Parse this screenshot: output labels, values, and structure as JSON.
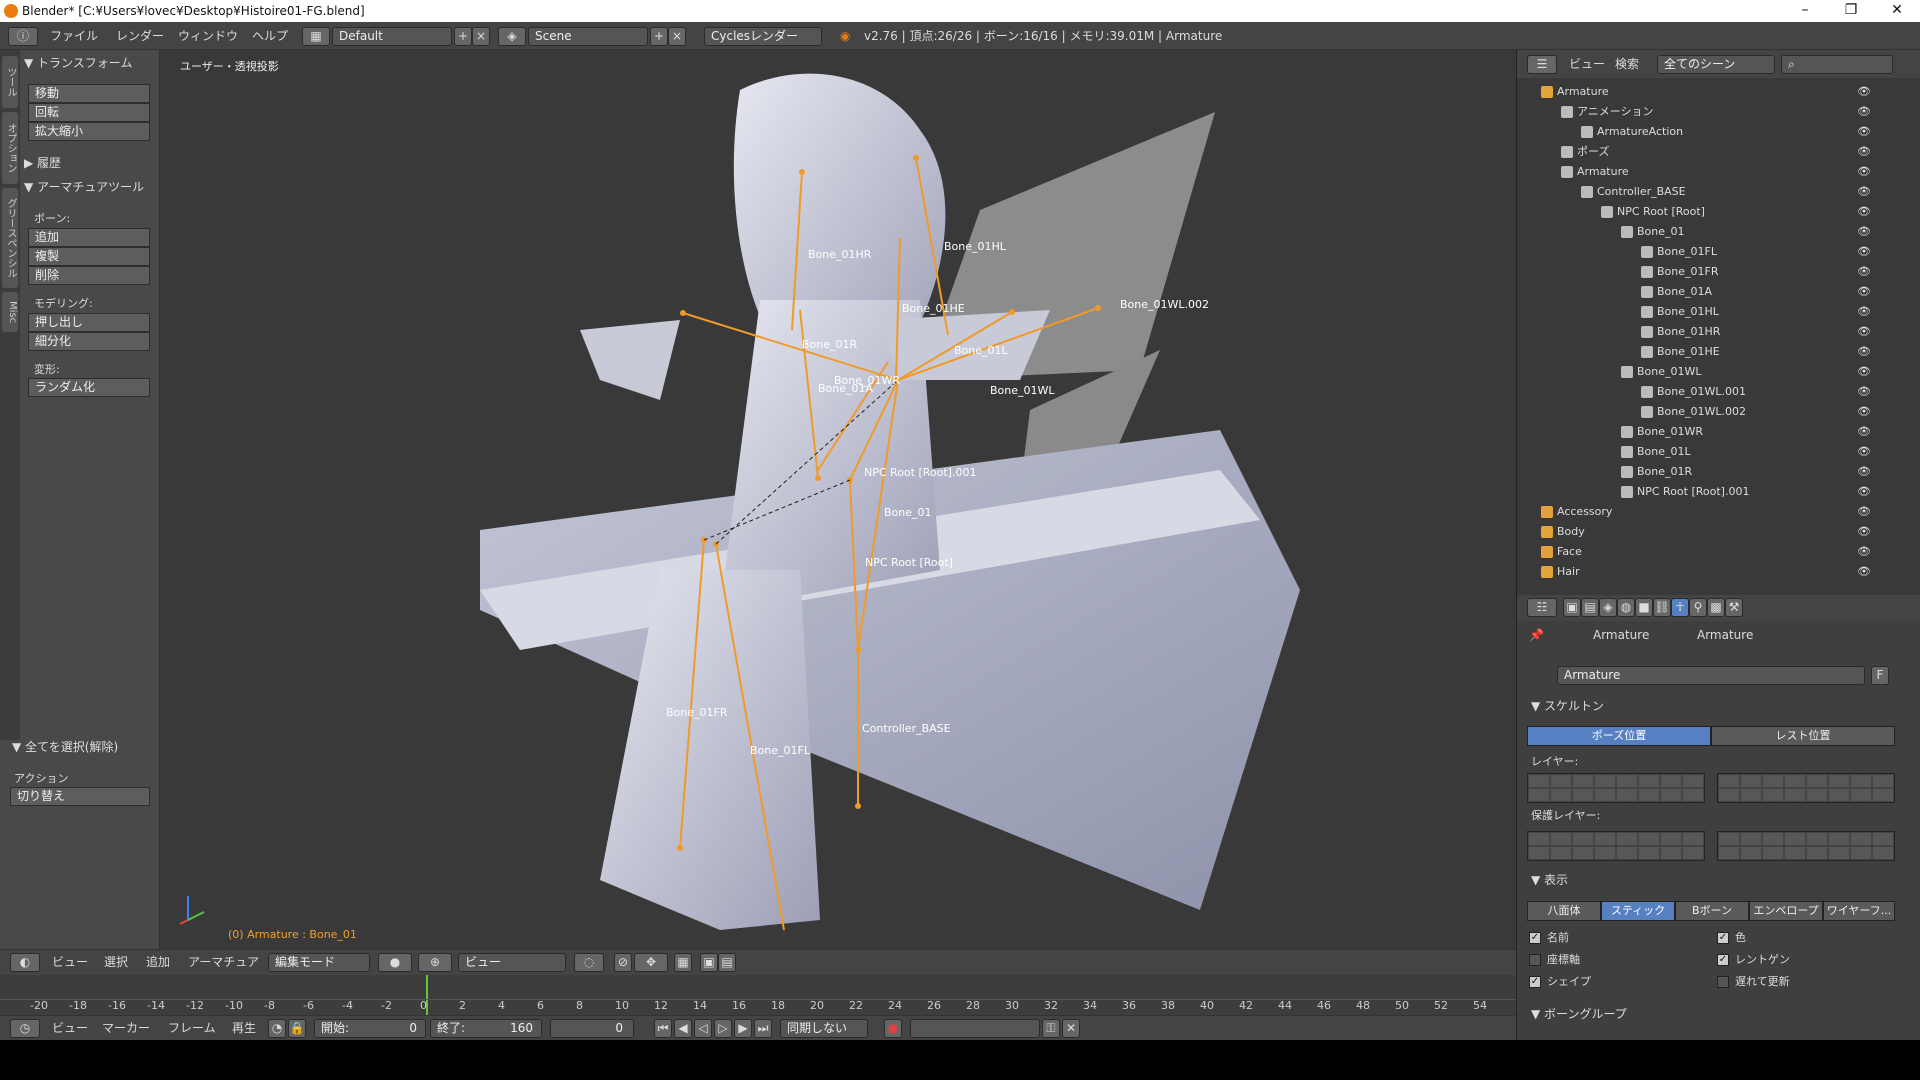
{
  "window": {
    "title": "Blender* [C:¥Users¥lovec¥Desktop¥Histoire01-FG.blend]"
  },
  "menu": [
    "ファイル",
    "レンダー",
    "ウィンドウ",
    "ヘルプ"
  ],
  "info": {
    "layout": "Default",
    "scene": "Scene",
    "engine": "Cyclesレンダー",
    "stats": "v2.76 | 頂点:26/26 | ボーン:16/16 | メモリ:39.01M | Armature"
  },
  "toolshelf": {
    "tabs": [
      "ツール",
      "オプション",
      "グリースペンシル",
      "Misc"
    ],
    "transform_header": "▼ トランスフォーム",
    "transform_buttons": [
      "移動",
      "回転",
      "拡大縮小"
    ],
    "history_header": "▶ 履歴",
    "armature_header": "▼ アーマチュアツール",
    "bones_label": "ボーン:",
    "bone_buttons": [
      "追加",
      "複製",
      "削除"
    ],
    "modeling_label": "モデリング:",
    "modeling_buttons": [
      "押し出し",
      "細分化"
    ],
    "deform_label": "変形:",
    "deform_buttons": [
      "ランダム化"
    ],
    "select_header": "▼ 全てを選択(解除)",
    "action_label": "アクション",
    "action_value": "切り替え"
  },
  "viewport": {
    "view_label": "ユーザー・透視投影",
    "status": "(0) Armature : Bone_01",
    "bone_labels": [
      "Bone_01HR",
      "Bone_01HL",
      "Bone_01HE",
      "Bone_01WL.002",
      "Bone_01R",
      "Bone_01L",
      "Bone_01WR",
      "Bone_01A",
      "Bone_01WL",
      "NPC Root [Root].001",
      "Bone_01",
      "NPC Root [Root]",
      "Bone_01FR",
      "Bone_01FL",
      "Controller_BASE"
    ]
  },
  "vp_header": {
    "items": [
      "ビュー",
      "選択",
      "追加",
      "アーマチュア"
    ],
    "mode": "編集モード",
    "view": "ビュー"
  },
  "timeline": {
    "ticks": [
      "-20",
      "-18",
      "-16",
      "-14",
      "-12",
      "-10",
      "-8",
      "-6",
      "-4",
      "-2",
      "0",
      "2",
      "4",
      "6",
      "8",
      "10",
      "12",
      "14",
      "16",
      "18",
      "20",
      "22",
      "24",
      "26",
      "28",
      "30",
      "32",
      "34",
      "36",
      "38",
      "40",
      "42",
      "44",
      "46",
      "48",
      "50",
      "52",
      "54"
    ],
    "footer": [
      "ビュー",
      "マーカー",
      "フレーム",
      "再生"
    ],
    "start_label": "開始:",
    "start": "0",
    "end_label": "終了:",
    "end": "160",
    "current": "0",
    "sync": "同期しない"
  },
  "outliner": {
    "menu": [
      "ビュー",
      "検索"
    ],
    "filter": "全てのシーン",
    "rows": [
      {
        "label": "Armature",
        "indent": 0,
        "color": "#e3a23a"
      },
      {
        "label": "アニメーション",
        "indent": 1,
        "color": "#bbb"
      },
      {
        "label": "ArmatureAction",
        "indent": 2,
        "color": "#bbb"
      },
      {
        "label": "ポーズ",
        "indent": 1,
        "color": "#bbb"
      },
      {
        "label": "Armature",
        "indent": 1,
        "color": "#bbb"
      },
      {
        "label": "Controller_BASE",
        "indent": 2,
        "color": "#bbb"
      },
      {
        "label": "NPC Root [Root]",
        "indent": 3,
        "color": "#bbb"
      },
      {
        "label": "Bone_01",
        "indent": 4,
        "color": "#bbb"
      },
      {
        "label": "Bone_01FL",
        "indent": 5,
        "color": "#bbb"
      },
      {
        "label": "Bone_01FR",
        "indent": 5,
        "color": "#bbb"
      },
      {
        "label": "Bone_01A",
        "indent": 5,
        "color": "#bbb"
      },
      {
        "label": "Bone_01HL",
        "indent": 5,
        "color": "#bbb"
      },
      {
        "label": "Bone_01HR",
        "indent": 5,
        "color": "#bbb"
      },
      {
        "label": "Bone_01HE",
        "indent": 5,
        "color": "#bbb"
      },
      {
        "label": "Bone_01WL",
        "indent": 4,
        "color": "#bbb"
      },
      {
        "label": "Bone_01WL.001",
        "indent": 5,
        "color": "#bbb"
      },
      {
        "label": "Bone_01WL.002",
        "indent": 5,
        "color": "#bbb"
      },
      {
        "label": "Bone_01WR",
        "indent": 4,
        "color": "#bbb"
      },
      {
        "label": "Bone_01L",
        "indent": 4,
        "color": "#bbb"
      },
      {
        "label": "Bone_01R",
        "indent": 4,
        "color": "#bbb"
      },
      {
        "label": "NPC Root [Root].001",
        "indent": 4,
        "color": "#bbb"
      },
      {
        "label": "Accessory",
        "indent": 0,
        "color": "#e3a23a"
      },
      {
        "label": "Body",
        "indent": 0,
        "color": "#e3a23a"
      },
      {
        "label": "Face",
        "indent": 0,
        "color": "#e3a23a"
      },
      {
        "label": "Hair",
        "indent": 0,
        "color": "#e3a23a"
      }
    ]
  },
  "props": {
    "crumb1": "Armature",
    "crumb2": "Armature",
    "name": "Armature",
    "fake_user": "F",
    "skeleton_header": "▼ スケルトン",
    "pose_pos": "ポーズ位置",
    "rest_pos": "レスト位置",
    "layer_label": "レイヤー:",
    "protected_label": "保護レイヤー:",
    "display_header": "▼ 表示",
    "display_modes": [
      "八面体",
      "スティック",
      "Bボーン",
      "エンベロープ",
      "ワイヤーフ..."
    ],
    "checks_left": [
      "名前",
      "座標軸",
      "シェイプ"
    ],
    "checks_right": [
      "色",
      "レントゲン",
      "遅れて更新"
    ],
    "bone_groups_header": "▼ ボーングループ"
  }
}
